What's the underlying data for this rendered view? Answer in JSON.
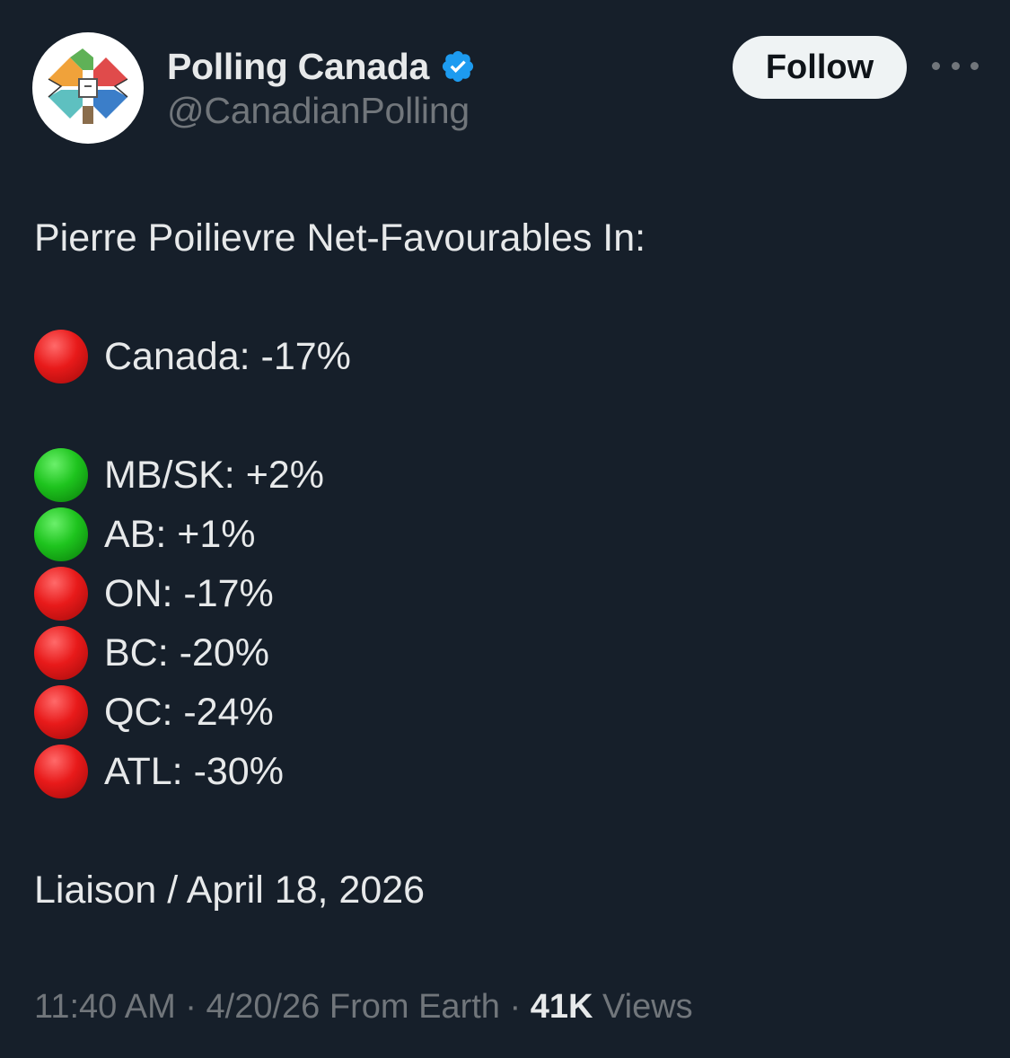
{
  "author": {
    "display_name": "Polling Canada",
    "handle": "@CanadianPolling",
    "verified_icon": "verified-badge-icon",
    "avatar_icon": "maple-leaf-logo-icon",
    "verified_color": "#1d9bf0"
  },
  "actions": {
    "follow_label": "Follow",
    "more_icon": "more-options-icon"
  },
  "tweet": {
    "title": "Pierre Poilievre Net-Favourables In:",
    "national": {
      "status": "red",
      "text": "Canada: -17%"
    },
    "regions": [
      {
        "status": "green",
        "text": "MB/SK: +2%"
      },
      {
        "status": "green",
        "text": "AB: +1%"
      },
      {
        "status": "red",
        "text": "ON: -17%"
      },
      {
        "status": "red",
        "text": "BC: -20%"
      },
      {
        "status": "red",
        "text": "QC: -24%"
      },
      {
        "status": "red",
        "text": "ATL: -30%"
      }
    ],
    "source": "Liaison / April 18, 2026"
  },
  "meta": {
    "time": "11:40 AM",
    "date": "4/20/26",
    "location": "From Earth",
    "views_count": "41K",
    "views_label": "Views",
    "separator": "·"
  },
  "colors": {
    "background": "#161f2a",
    "text": "#e7e9ea",
    "muted": "#71767b",
    "red_dot": "#e81a1a",
    "green_dot": "#1ec41e"
  }
}
